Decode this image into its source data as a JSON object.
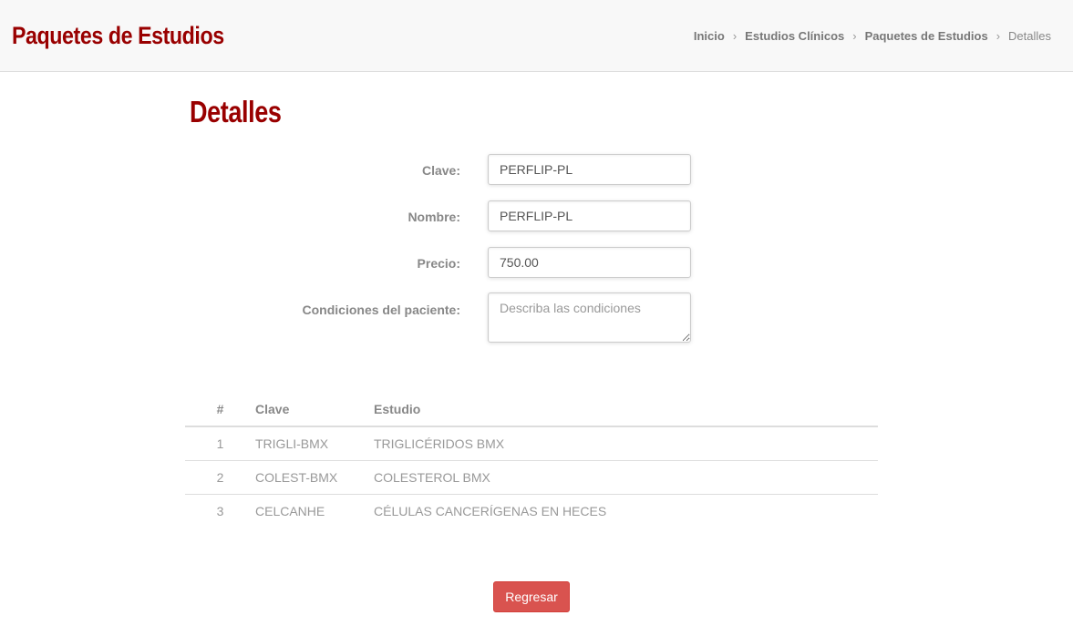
{
  "header": {
    "title": "Paquetes de Estudios",
    "breadcrumb": {
      "items": [
        "Inicio",
        "Estudios Clínicos",
        "Paquetes de Estudios"
      ],
      "current": "Detalles",
      "separator": "›"
    }
  },
  "main": {
    "title": "Detalles",
    "form": {
      "clave_label": "Clave:",
      "clave_value": "PERFLIP-PL",
      "nombre_label": "Nombre:",
      "nombre_value": "PERFLIP-PL",
      "precio_label": "Precio:",
      "precio_value": "750.00",
      "condiciones_label": "Condiciones del paciente:",
      "condiciones_placeholder": "Describa las condiciones",
      "condiciones_value": ""
    },
    "table": {
      "headers": [
        "#",
        "Clave",
        "Estudio"
      ],
      "rows": [
        [
          "1",
          "TRIGLI-BMX",
          "TRIGLICÉRIDOS BMX"
        ],
        [
          "2",
          "COLEST-BMX",
          "COLESTEROL BMX"
        ],
        [
          "3",
          "CELCANHE",
          "CÉLULAS CANCERÍGENAS EN HECES"
        ]
      ]
    },
    "back_button_label": "Regresar"
  },
  "colors": {
    "brand": "#990000",
    "danger_button": "#d9534f"
  }
}
